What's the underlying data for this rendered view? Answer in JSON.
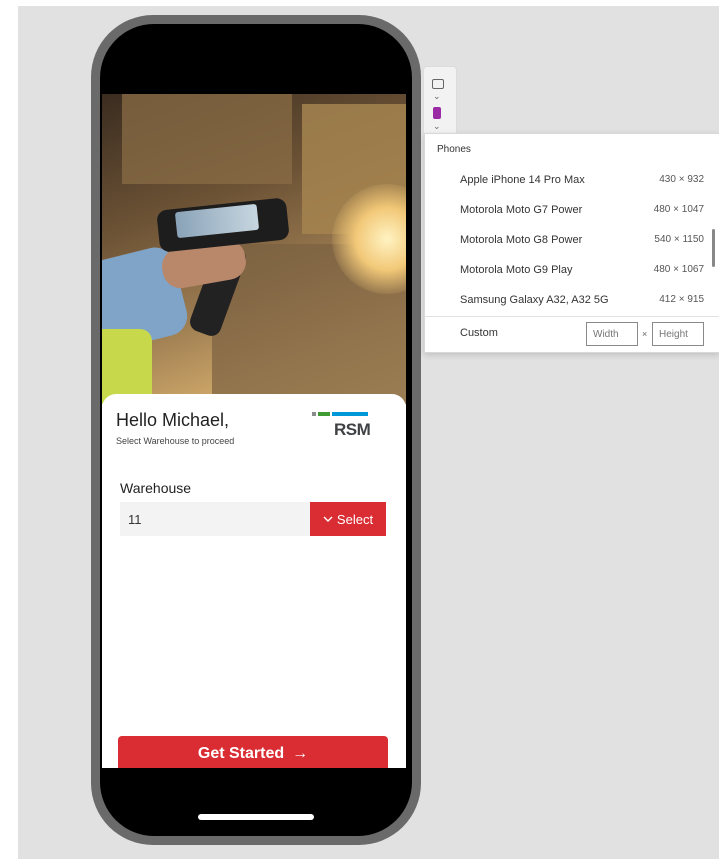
{
  "app": {
    "greeting": "Hello Michael,",
    "subtitle": "Select Warehouse to proceed",
    "logo_text": "RSM",
    "warehouse_label": "Warehouse",
    "warehouse_value": "11",
    "select_label": "Select",
    "get_started_label": "Get Started",
    "get_started_arrow": "→",
    "colors": {
      "accent": "#d92c33",
      "logo_gray": "#8c8c8c",
      "logo_green": "#3f9c35",
      "logo_blue": "#0098d8"
    }
  },
  "device_panel": {
    "header": "Phones",
    "devices": [
      {
        "name": "Apple iPhone 14 Pro Max",
        "size": "430 × 932"
      },
      {
        "name": "Motorola Moto G7 Power",
        "size": "480 × 1047"
      },
      {
        "name": "Motorola Moto G8 Power",
        "size": "540 × 1150"
      },
      {
        "name": "Motorola Moto G9 Play",
        "size": "480 × 1067"
      },
      {
        "name": "Samsung Galaxy A32, A32 5G",
        "size": "412 × 915"
      }
    ],
    "custom_label": "Custom",
    "width_placeholder": "Width",
    "times": "×",
    "height_placeholder": "Height"
  },
  "toolbar": {
    "icons": [
      "screen-icon",
      "chevron-down-icon",
      "phone-icon",
      "chevron-down-icon"
    ]
  }
}
